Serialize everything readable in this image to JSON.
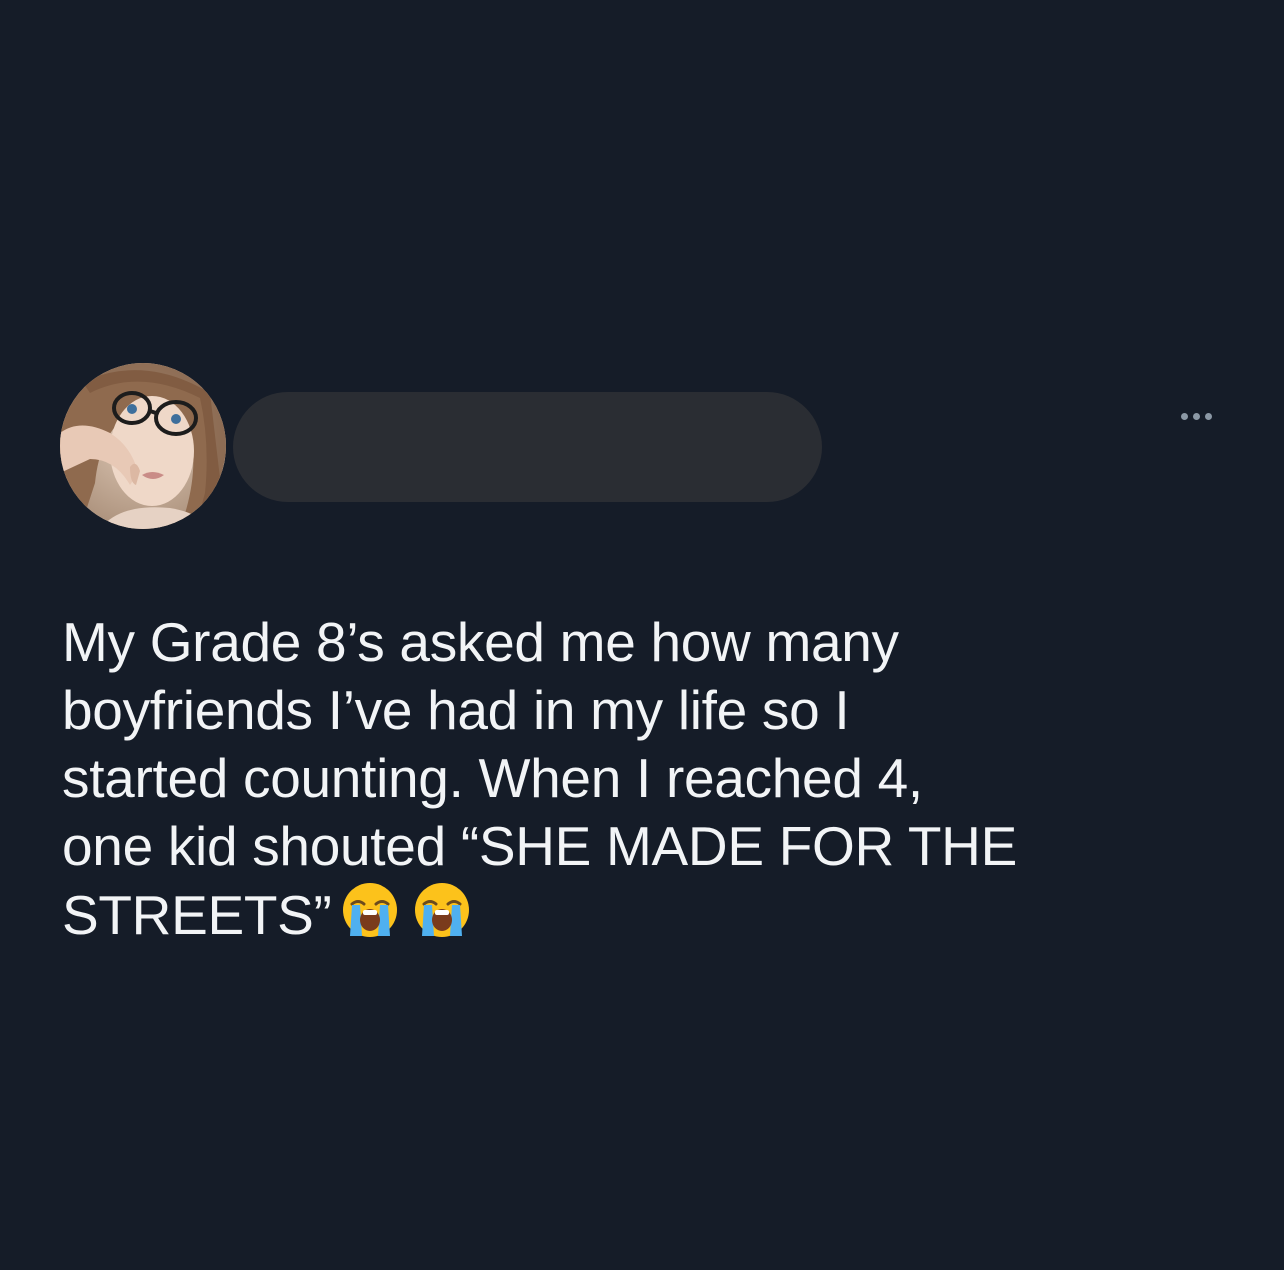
{
  "tweet": {
    "avatar_icon": "profile-photo",
    "display_name_redacted": true,
    "more_icon": "more-horizontal-icon",
    "text_lines": [
      "My Grade 8’s asked me how many",
      "boyfriends I’ve had in my life so I",
      "started counting. When I reached 4,",
      "one kid shouted “SHE MADE FOR THE",
      "STREETS”"
    ],
    "emojis": [
      "loudly-crying-face-icon",
      "loudly-crying-face-icon"
    ]
  },
  "colors": {
    "background": "#151c28",
    "text": "#f2f4f6",
    "redaction": "#2a2d33",
    "muted": "#8b98a5"
  }
}
